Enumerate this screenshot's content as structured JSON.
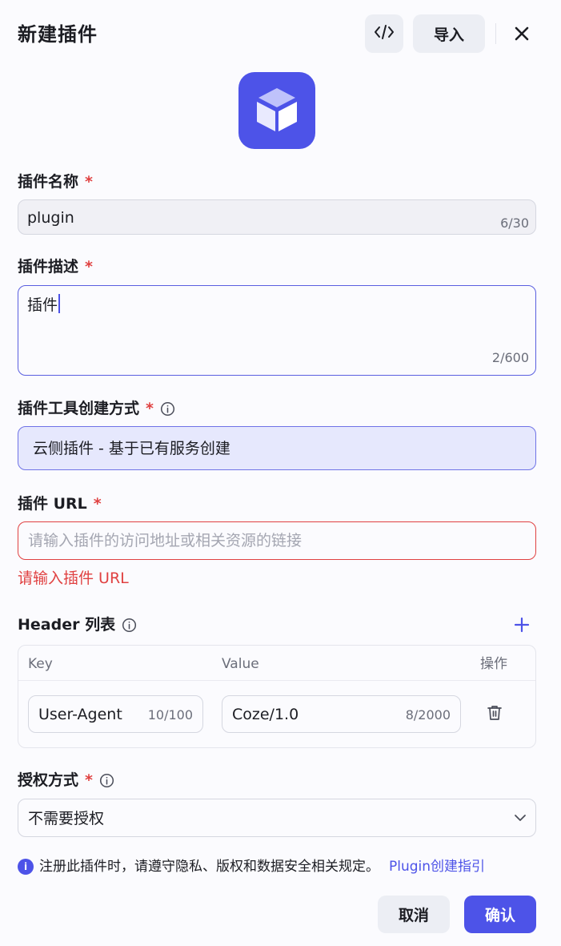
{
  "dialog": {
    "title": "新建插件",
    "code_icon": "code-icon",
    "import_label": "导入",
    "close_icon": "close-icon"
  },
  "avatar": {
    "icon": "cube-icon",
    "color": "#4d53e8"
  },
  "name_field": {
    "label": "插件名称",
    "required_mark": "*",
    "value": "plugin",
    "counter": "6/30"
  },
  "desc_field": {
    "label": "插件描述",
    "required_mark": "*",
    "value": "插件",
    "counter": "2/600"
  },
  "method_field": {
    "label": "插件工具创建方式",
    "required_mark": "*",
    "value": "云侧插件 - 基于已有服务创建"
  },
  "url_field": {
    "label": "插件 URL",
    "required_mark": "*",
    "placeholder": "请输入插件的访问地址或相关资源的链接",
    "value": "",
    "error": "请输入插件 URL"
  },
  "header_list": {
    "label": "Header 列表",
    "columns": {
      "key": "Key",
      "value": "Value",
      "action": "操作"
    },
    "rows": [
      {
        "key": "User-Agent",
        "key_counter": "10/100",
        "value": "Coze/1.0",
        "value_counter": "8/2000"
      }
    ]
  },
  "auth_field": {
    "label": "授权方式",
    "required_mark": "*",
    "value": "不需要授权"
  },
  "notice": {
    "icon_text": "i",
    "text": "注册此插件时，请遵守隐私、版权和数据安全相关规定。",
    "link": "Plugin创建指引"
  },
  "footer": {
    "cancel_label": "取消",
    "confirm_label": "确认"
  },
  "colors": {
    "accent": "#4d53e8",
    "error": "#e04141",
    "background": "#fbfbfe"
  }
}
